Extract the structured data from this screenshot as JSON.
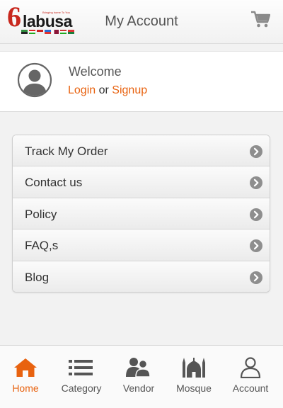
{
  "header": {
    "title": "My Account",
    "logo_text": "labusa",
    "logo_digit": "6",
    "logo_tagline": "Bringing home To You",
    "cart_icon": "cart-icon"
  },
  "profile": {
    "welcome": "Welcome",
    "login": "Login",
    "or": "or",
    "signup": "Signup",
    "avatar_icon": "user-avatar-icon"
  },
  "menu": {
    "items": [
      {
        "label": "Track My Order"
      },
      {
        "label": "Contact us"
      },
      {
        "label": "Policy"
      },
      {
        "label": "FAQ,s"
      },
      {
        "label": "Blog"
      }
    ],
    "chevron_icon": "chevron-right-circle-icon"
  },
  "tabbar": {
    "tabs": [
      {
        "label": "Home",
        "icon": "home-icon"
      },
      {
        "label": "Category",
        "icon": "list-icon"
      },
      {
        "label": "Vendor",
        "icon": "users-icon"
      },
      {
        "label": "Mosque",
        "icon": "mosque-icon"
      },
      {
        "label": "Account",
        "icon": "user-icon"
      }
    ]
  },
  "colors": {
    "accent": "#e8620f",
    "brand_red": "#c8281e",
    "text": "#555555",
    "background": "#f2f2f2"
  }
}
